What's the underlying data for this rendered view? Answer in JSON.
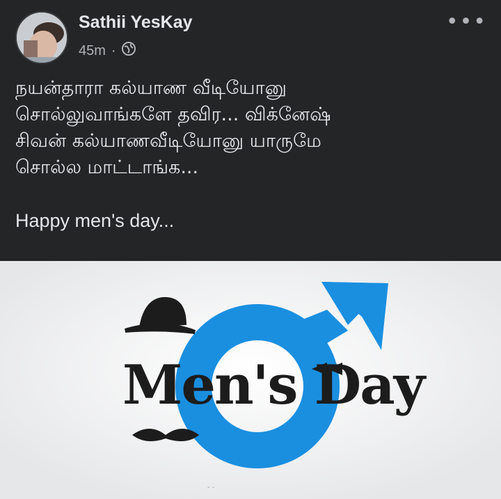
{
  "post": {
    "author": "Sathii YesKay",
    "time": "45m",
    "separator": "·",
    "privacy_icon": "globe-icon",
    "more_icon": "more-horizontal-icon",
    "more_label": "•••",
    "text_lines": [
      "நயன்தாரா கல்யாண வீடியோனு",
      "சொல்லுவாங்களே தவிர... விக்னேஷ்",
      "சிவன் கல்யாணவீடியோனு யாருமே",
      "சொல்ல மாட்டாங்க..."
    ],
    "text_footer": "Happy men's day..."
  },
  "image": {
    "caption_text": "Men's Day",
    "colors": {
      "accent_blue": "#1a8fe0",
      "dark": "#1c1c1c"
    }
  },
  "theme": {
    "background": "#242526",
    "text": "#e4e6eb",
    "muted": "#b0b3b8"
  }
}
